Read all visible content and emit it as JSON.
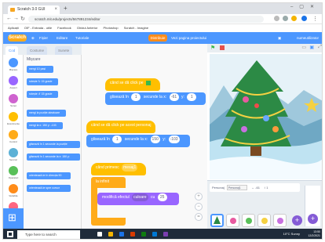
{
  "browser": {
    "tab_title": "Scratch 3.0 GUI",
    "url": "scratch.mit.edu/projects/567891234/editor",
    "bookmarks": [
      "Aplicații",
      "OIF - Entrada - utile",
      "Facebook",
      "Ghidul Anterior",
      "Photoshop",
      "Scratch - Imagine"
    ]
  },
  "menubar": {
    "logo": "Scratch",
    "items": [
      "Fișier",
      "Editare",
      "Tutoriale"
    ],
    "share_label": "Distribuie",
    "see_page_label": "Vezi pagina proiectului",
    "user": "numeutilizator"
  },
  "subtabs": [
    "Cod",
    "Costume",
    "Sunete"
  ],
  "categories": [
    {
      "label": "Mișcare",
      "color": "#4c97ff"
    },
    {
      "label": "Aspect",
      "color": "#9966ff"
    },
    {
      "label": "Sunet",
      "color": "#cf63cf"
    },
    {
      "label": "Evenimente",
      "color": "#ffbf00"
    },
    {
      "label": "Control",
      "color": "#ffab19"
    },
    {
      "label": "Senzori",
      "color": "#5cb1d6"
    },
    {
      "label": "Operatori",
      "color": "#59c059"
    },
    {
      "label": "Variabile",
      "color": "#ff8c1a"
    },
    {
      "label": "Blocurile Mele",
      "color": "#ff6680"
    }
  ],
  "palette": {
    "title": "Mișcare",
    "blocks": [
      {
        "text": "mergi 10 pași",
        "type": "motion"
      },
      {
        "text": "rotește ↻ 15 grade",
        "type": "motion"
      },
      {
        "text": "rotește ↺ 15 grade",
        "type": "motion"
      },
      {
        "text": "mergi la poziție aleatoare",
        "type": "motion"
      },
      {
        "text": "mergi la x: 150 y: -103",
        "type": "motion"
      },
      {
        "text": "glisează în 1 secunde la poziție",
        "type": "motion"
      },
      {
        "text": "glisează în 1 secunde la x: 150 y:",
        "type": "motion"
      },
      {
        "text": "orientează-te în direcția 90",
        "type": "motion"
      },
      {
        "text": "orientează-te spre cursor",
        "type": "motion"
      }
    ]
  },
  "scripts": {
    "hat1": "când se dă click pe",
    "glide1": {
      "prefix": "glisează în",
      "secs": "1",
      "mid": "secunde la x:",
      "x": "-61",
      "ylabel": "y:",
      "y": "1"
    },
    "hat2": "când se dă click pe acest personaj",
    "glide2": {
      "prefix": "glisează în",
      "secs": "1",
      "mid": "secunde la x:",
      "x": "150",
      "ylabel": "y:",
      "y": "-103"
    },
    "hat3": "când primesc",
    "hat3_msg": "mesaj1",
    "forever": "la infinit",
    "effect": {
      "prefix": "modifică efectul",
      "effect": "culoare",
      "mid": "cu",
      "value": "25"
    }
  },
  "stage_info": {
    "sprite_label": "Personaj",
    "sprite_name": "Personaj1",
    "x": "-61",
    "y": "1"
  },
  "taskbar": {
    "search_placeholder": "Type here to search",
    "weather": "10°C Sunny",
    "time": "13:50",
    "date": "12/2/2021"
  }
}
